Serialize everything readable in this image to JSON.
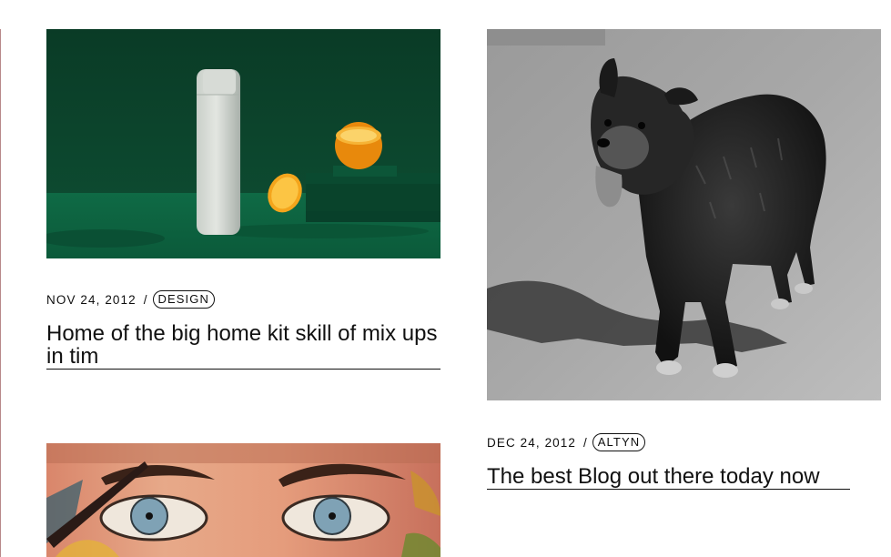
{
  "posts": [
    {
      "date": "NOV 24, 2012",
      "separator": "/",
      "category": "DESIGN",
      "title": "Home of the big home kit skill of mix ups in tim",
      "image": "white-bottle-and-oranges-on-green"
    },
    {
      "date": "DEC 24, 2012",
      "separator": "/",
      "category": "ALTYN",
      "title": "The best Blog out there today now",
      "image": "black-and-white-dog-photo"
    },
    {
      "image": "graffiti-mural-eyes"
    }
  ],
  "colors": {
    "accent_edge": "#b8898a",
    "text": "#0f0f0f",
    "green_bg": "#0c4a30",
    "orange": "#f0a020"
  }
}
